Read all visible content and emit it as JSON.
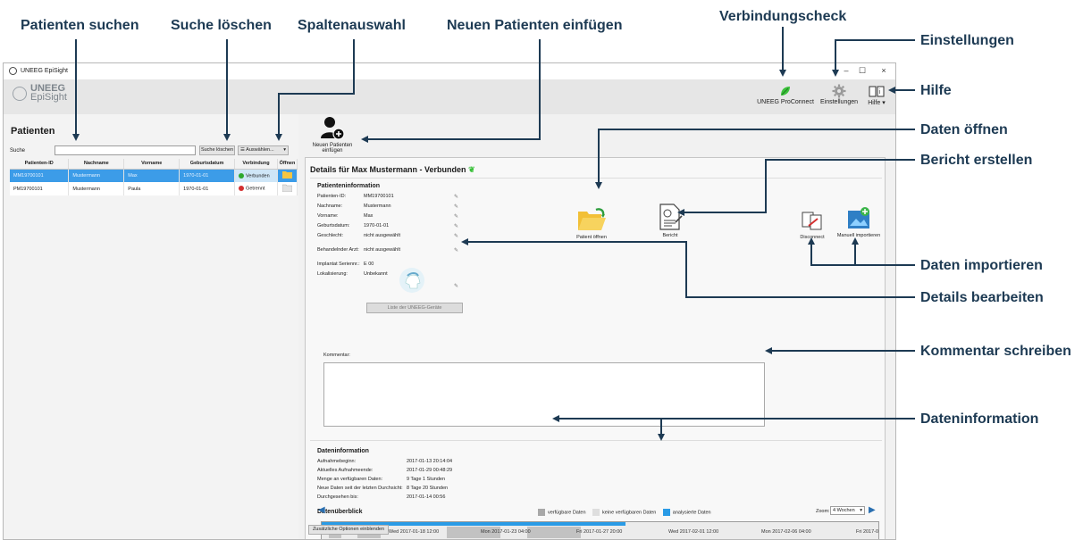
{
  "callouts": {
    "search": "Patienten suchen",
    "clear": "Suche löschen",
    "columns": "Spaltenauswahl",
    "new_patient": "Neuen Patienten einfügen",
    "connection": "Verbindungscheck",
    "settings": "Einstellungen",
    "help": "Hilfe",
    "open_data": "Daten öffnen",
    "create_report": "Bericht erstellen",
    "import_data": "Daten importieren",
    "edit_details": "Details bearbeiten",
    "write_comment": "Kommentar schreiben",
    "data_info": "Dateninformation"
  },
  "window": {
    "title": "UNEEG EpiSight",
    "minimize": "–",
    "maximize": "☐",
    "close": "×"
  },
  "brand": {
    "line1": "UNEEG",
    "line2": "EpiSight"
  },
  "toolbar": {
    "proconnect": "UNEEG ProConnect",
    "settings": "Einstellungen",
    "help": "Hilfe"
  },
  "patients": {
    "title": "Patienten",
    "search_label": "Suche",
    "search_value": "",
    "clear_button": "Suche löschen",
    "columns_button": "Auswählen...",
    "headers": [
      "Patienten-ID",
      "Nachname",
      "Vorname",
      "Geburtsdatum",
      "Verbindung",
      "Öffnen"
    ],
    "rows": [
      {
        "id": "MM19700101",
        "last": "Mustermann",
        "first": "Max",
        "dob": "1970-01-01",
        "status": "Verbunden",
        "status_color": "#2ea82e"
      },
      {
        "id": "PM19700101",
        "last": "Mustermann",
        "first": "Paula",
        "dob": "1970-01-01",
        "status": "Getrennt",
        "status_color": "#d32f2f"
      }
    ]
  },
  "new_patient_label": "Neuen Patienten einfügen",
  "details": {
    "title": "Details für Max Mustermann - Verbunden",
    "section": "Patienteninformation",
    "fields": [
      {
        "k": "Patienten-ID:",
        "v": "MM19700101"
      },
      {
        "k": "Nachname:",
        "v": "Mustermann"
      },
      {
        "k": "Vorname:",
        "v": "Max"
      },
      {
        "k": "Geburtsdatum:",
        "v": "1970-01-01"
      },
      {
        "k": "Geschlecht:",
        "v": "nicht ausgewählt"
      }
    ],
    "doctor_label": "Behandelnder Arzt:",
    "doctor_value": "nicht ausgewählt",
    "implant_label": "Implantat Seriennr.:",
    "implant_value": "E 00",
    "location_label": "Lokalisierung:",
    "location_value": "Unbekannt",
    "devices_button": "Liste der UNEEG-Geräte",
    "open_patient": "Patient öffnen",
    "report": "Bericht",
    "disconnect": "Disconnect",
    "manual_import": "Manuell importieren",
    "comment_label": "Kommentar:",
    "comment_value": ""
  },
  "datainfo": {
    "title": "Dateninformation",
    "rows": [
      {
        "k": "Aufnahmebeginn:",
        "v": "2017-01-13 20:14:04"
      },
      {
        "k": "Aktuelles Aufnahmeende:",
        "v": "2017-01-29 00:48:29"
      },
      {
        "k": "Menge an verfügbaren Daten:",
        "v": "9 Tage 1 Stunden"
      },
      {
        "k": "Neue Daten seit der letzten Durchsicht:",
        "v": "8 Tage 20 Stunden"
      },
      {
        "k": "Durchgesehen bis:",
        "v": "2017-01-14 00:56"
      }
    ],
    "overview_title": "Datenüberblick",
    "legend": [
      {
        "label": "verfügbare Daten",
        "color": "#a8a8a8"
      },
      {
        "label": "keine verfügbaren Daten",
        "color": "#dedede"
      },
      {
        "label": "analysierte Daten",
        "color": "#2a9be6"
      }
    ],
    "ticks": [
      "Wed 2017-01-18 12:00",
      "Mon 2017-01-23 04:00",
      "Fri 2017-01-27 20:00",
      "Wed 2017-02-01 12:00",
      "Mon 2017-02-06 04:00",
      "Fri 2017-0"
    ],
    "analyzed_fraction": 0.545,
    "zoom_label": "Zoom:",
    "zoom_value": "4 Wochen",
    "more_options": "Zusätzliche Optionen einblenden"
  }
}
